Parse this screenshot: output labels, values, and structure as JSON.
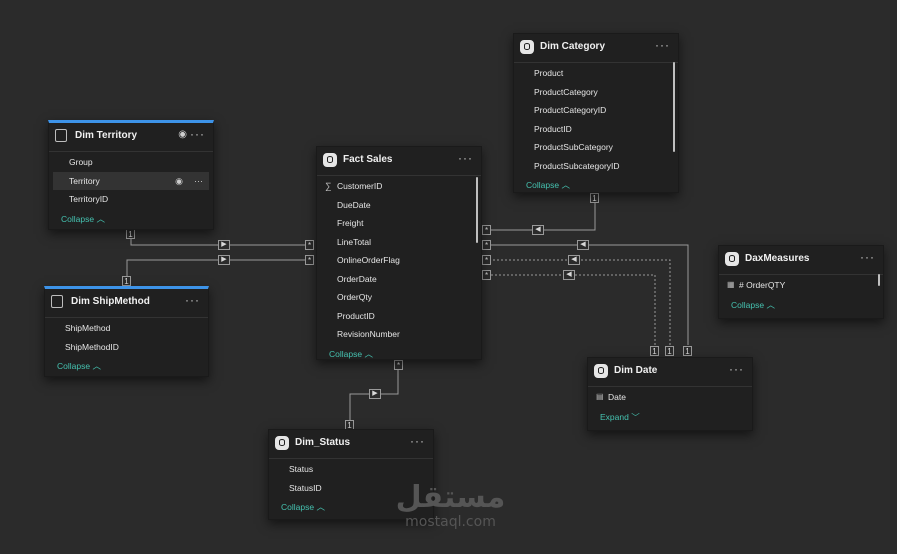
{
  "tables": {
    "dim_territory": {
      "title": "Dim Territory",
      "fields": [
        "Group",
        "Territory",
        "TerritoryID"
      ],
      "collapse": "Collapse"
    },
    "dim_shipmethod": {
      "title": "Dim ShipMethod",
      "fields": [
        "ShipMethod",
        "ShipMethodID"
      ],
      "collapse": "Collapse"
    },
    "fact_sales": {
      "title": "Fact Sales",
      "fields": [
        "CustomerID",
        "DueDate",
        "Freight",
        "LineTotal",
        "OnlineOrderFlag",
        "OrderDate",
        "OrderQty",
        "ProductID",
        "RevisionNumber"
      ],
      "collapse": "Collapse"
    },
    "dim_category": {
      "title": "Dim Category",
      "fields": [
        "Product",
        "ProductCategory",
        "ProductCategoryID",
        "ProductID",
        "ProductSubCategory",
        "ProductSubcategoryID"
      ],
      "collapse": "Collapse"
    },
    "dax_measures": {
      "title": "DaxMeasures",
      "fields": [
        "# OrderQTY"
      ],
      "collapse": "Collapse"
    },
    "dim_date": {
      "title": "Dim Date",
      "fields": [
        "Date"
      ],
      "expand": "Expand"
    },
    "dim_status": {
      "title": "Dim_Status",
      "fields": [
        "Status",
        "StatusID"
      ],
      "collapse": "Collapse"
    }
  },
  "relationships": {
    "one": "1",
    "many": "*"
  },
  "icons": {
    "more": "more-options-icon",
    "visibility": "eye-icon",
    "sum": "sigma-icon",
    "calendar": "calendar-icon",
    "table": "table-icon"
  },
  "watermark": {
    "arabic": "مستقل",
    "latin": "mostaql.com"
  },
  "colors": {
    "accent": "#45c2b0",
    "selected": "#3d93e8",
    "canvas": "#2b2b2b",
    "card": "#202020"
  }
}
